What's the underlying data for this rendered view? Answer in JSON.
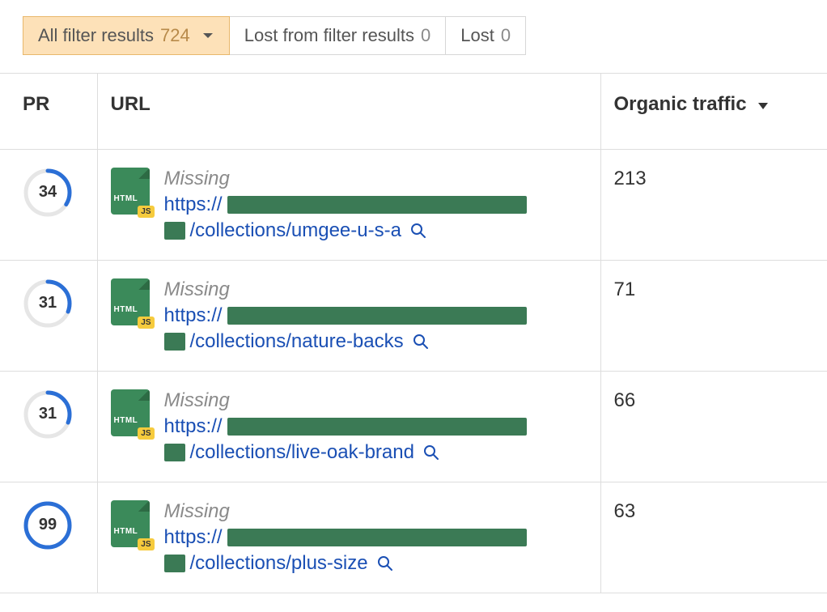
{
  "filters": {
    "tabs": [
      {
        "label": "All filter results",
        "count": "724",
        "active": true,
        "has_caret": true
      },
      {
        "label": "Lost from filter results",
        "count": "0",
        "active": false,
        "has_caret": false
      },
      {
        "label": "Lost",
        "count": "0",
        "active": false,
        "has_caret": false
      }
    ]
  },
  "columns": {
    "pr": "PR",
    "url": "URL",
    "traffic": "Organic traffic"
  },
  "file_badge": {
    "type": "HTML",
    "js": "JS"
  },
  "rows": [
    {
      "pr": "34",
      "pr_pct": 34,
      "status": "Missing",
      "protocol": "https://",
      "path": "/collections/umgee-u-s-a",
      "traffic": "213"
    },
    {
      "pr": "31",
      "pr_pct": 31,
      "status": "Missing",
      "protocol": "https://",
      "path": "/collections/nature-backs",
      "traffic": "71"
    },
    {
      "pr": "31",
      "pr_pct": 31,
      "status": "Missing",
      "protocol": "https://",
      "path": "/collections/live-oak-brand",
      "traffic": "66"
    },
    {
      "pr": "99",
      "pr_pct": 99,
      "status": "Missing",
      "protocol": "https://",
      "path": "/collections/plus-size",
      "traffic": "63"
    }
  ]
}
